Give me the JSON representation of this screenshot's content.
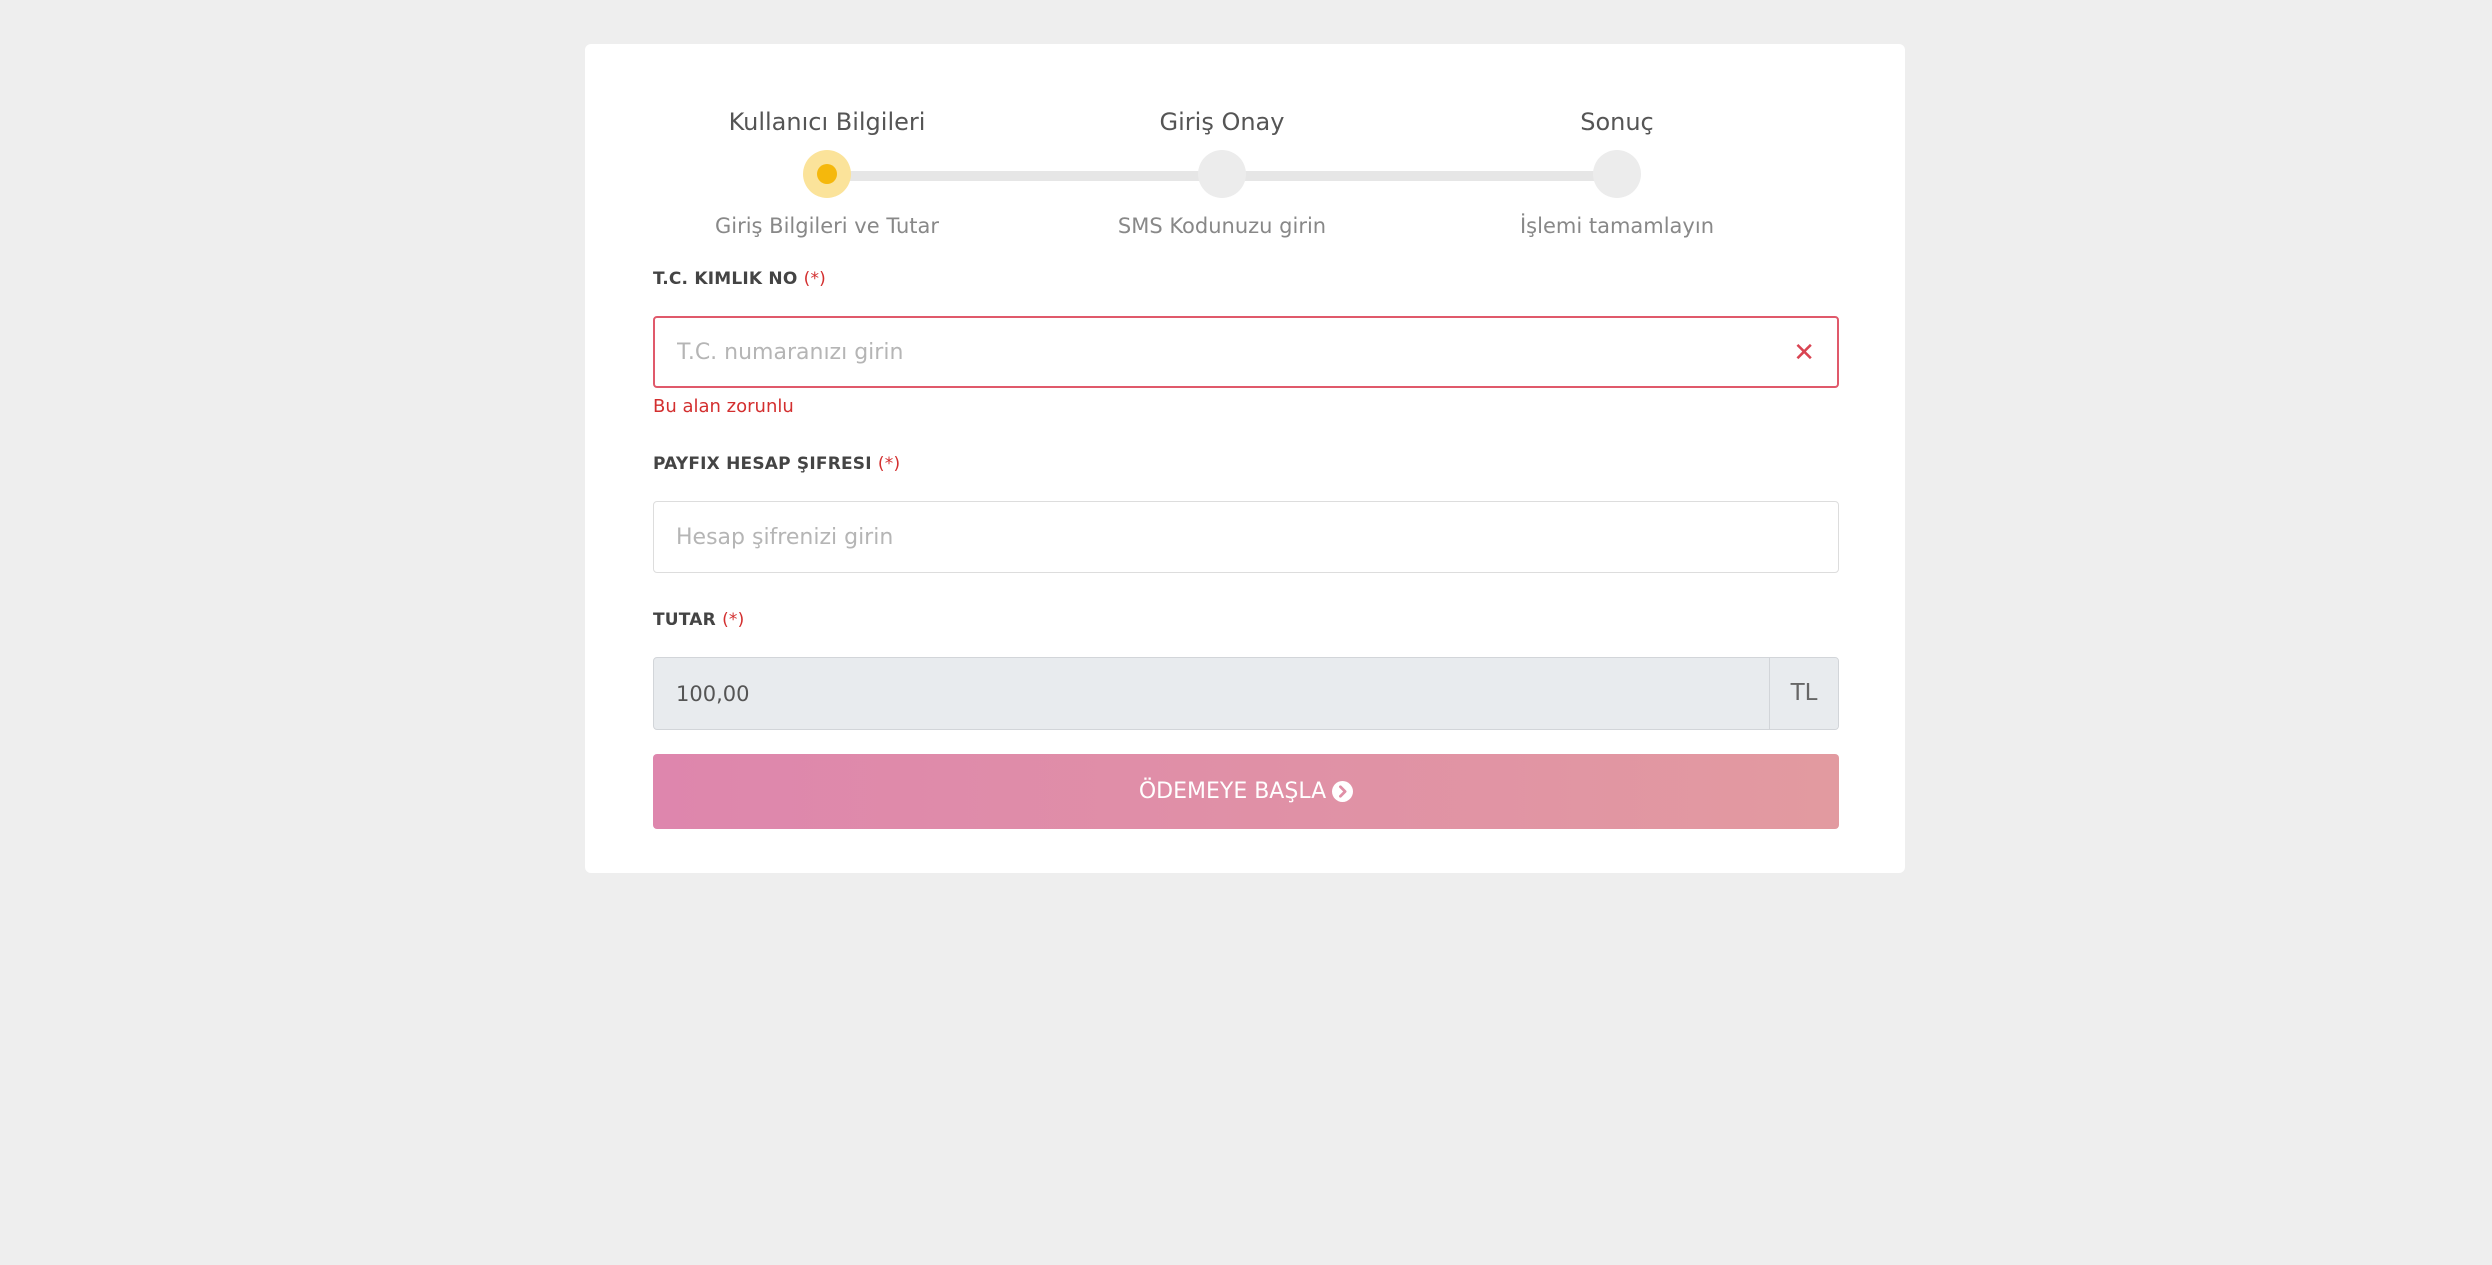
{
  "stepper": {
    "steps": [
      {
        "title": "Kullanıcı Bilgileri",
        "subtitle": "Giriş Bilgileri ve Tutar",
        "active": true
      },
      {
        "title": "Giriş Onay",
        "subtitle": "SMS Kodunuzu girin",
        "active": false
      },
      {
        "title": "Sonuç",
        "subtitle": "İşlemi tamamlayın",
        "active": false
      }
    ]
  },
  "form": {
    "tc": {
      "label": "T.C. KIMLIK NO",
      "required_mark": "(*)",
      "placeholder": "T.C. numaranızı girin",
      "value": "",
      "error": "Bu alan zorunlu"
    },
    "password": {
      "label": "PAYFIX HESAP ŞIFRESI",
      "required_mark": "(*)",
      "placeholder": "Hesap şifrenizi girin",
      "value": ""
    },
    "amount": {
      "label": "TUTAR",
      "required_mark": "(*)",
      "value": "100,00",
      "currency": "TL"
    },
    "submit_label": "ÖDEMEYE BAŞLA"
  },
  "colors": {
    "active_step": "#f5b80c",
    "error": "#d32f2f",
    "button_gradient_start": "#de86ad",
    "button_gradient_end": "#e29aa0"
  },
  "icons": {
    "clear": "close-icon",
    "submit": "chevron-circle-right-icon"
  }
}
